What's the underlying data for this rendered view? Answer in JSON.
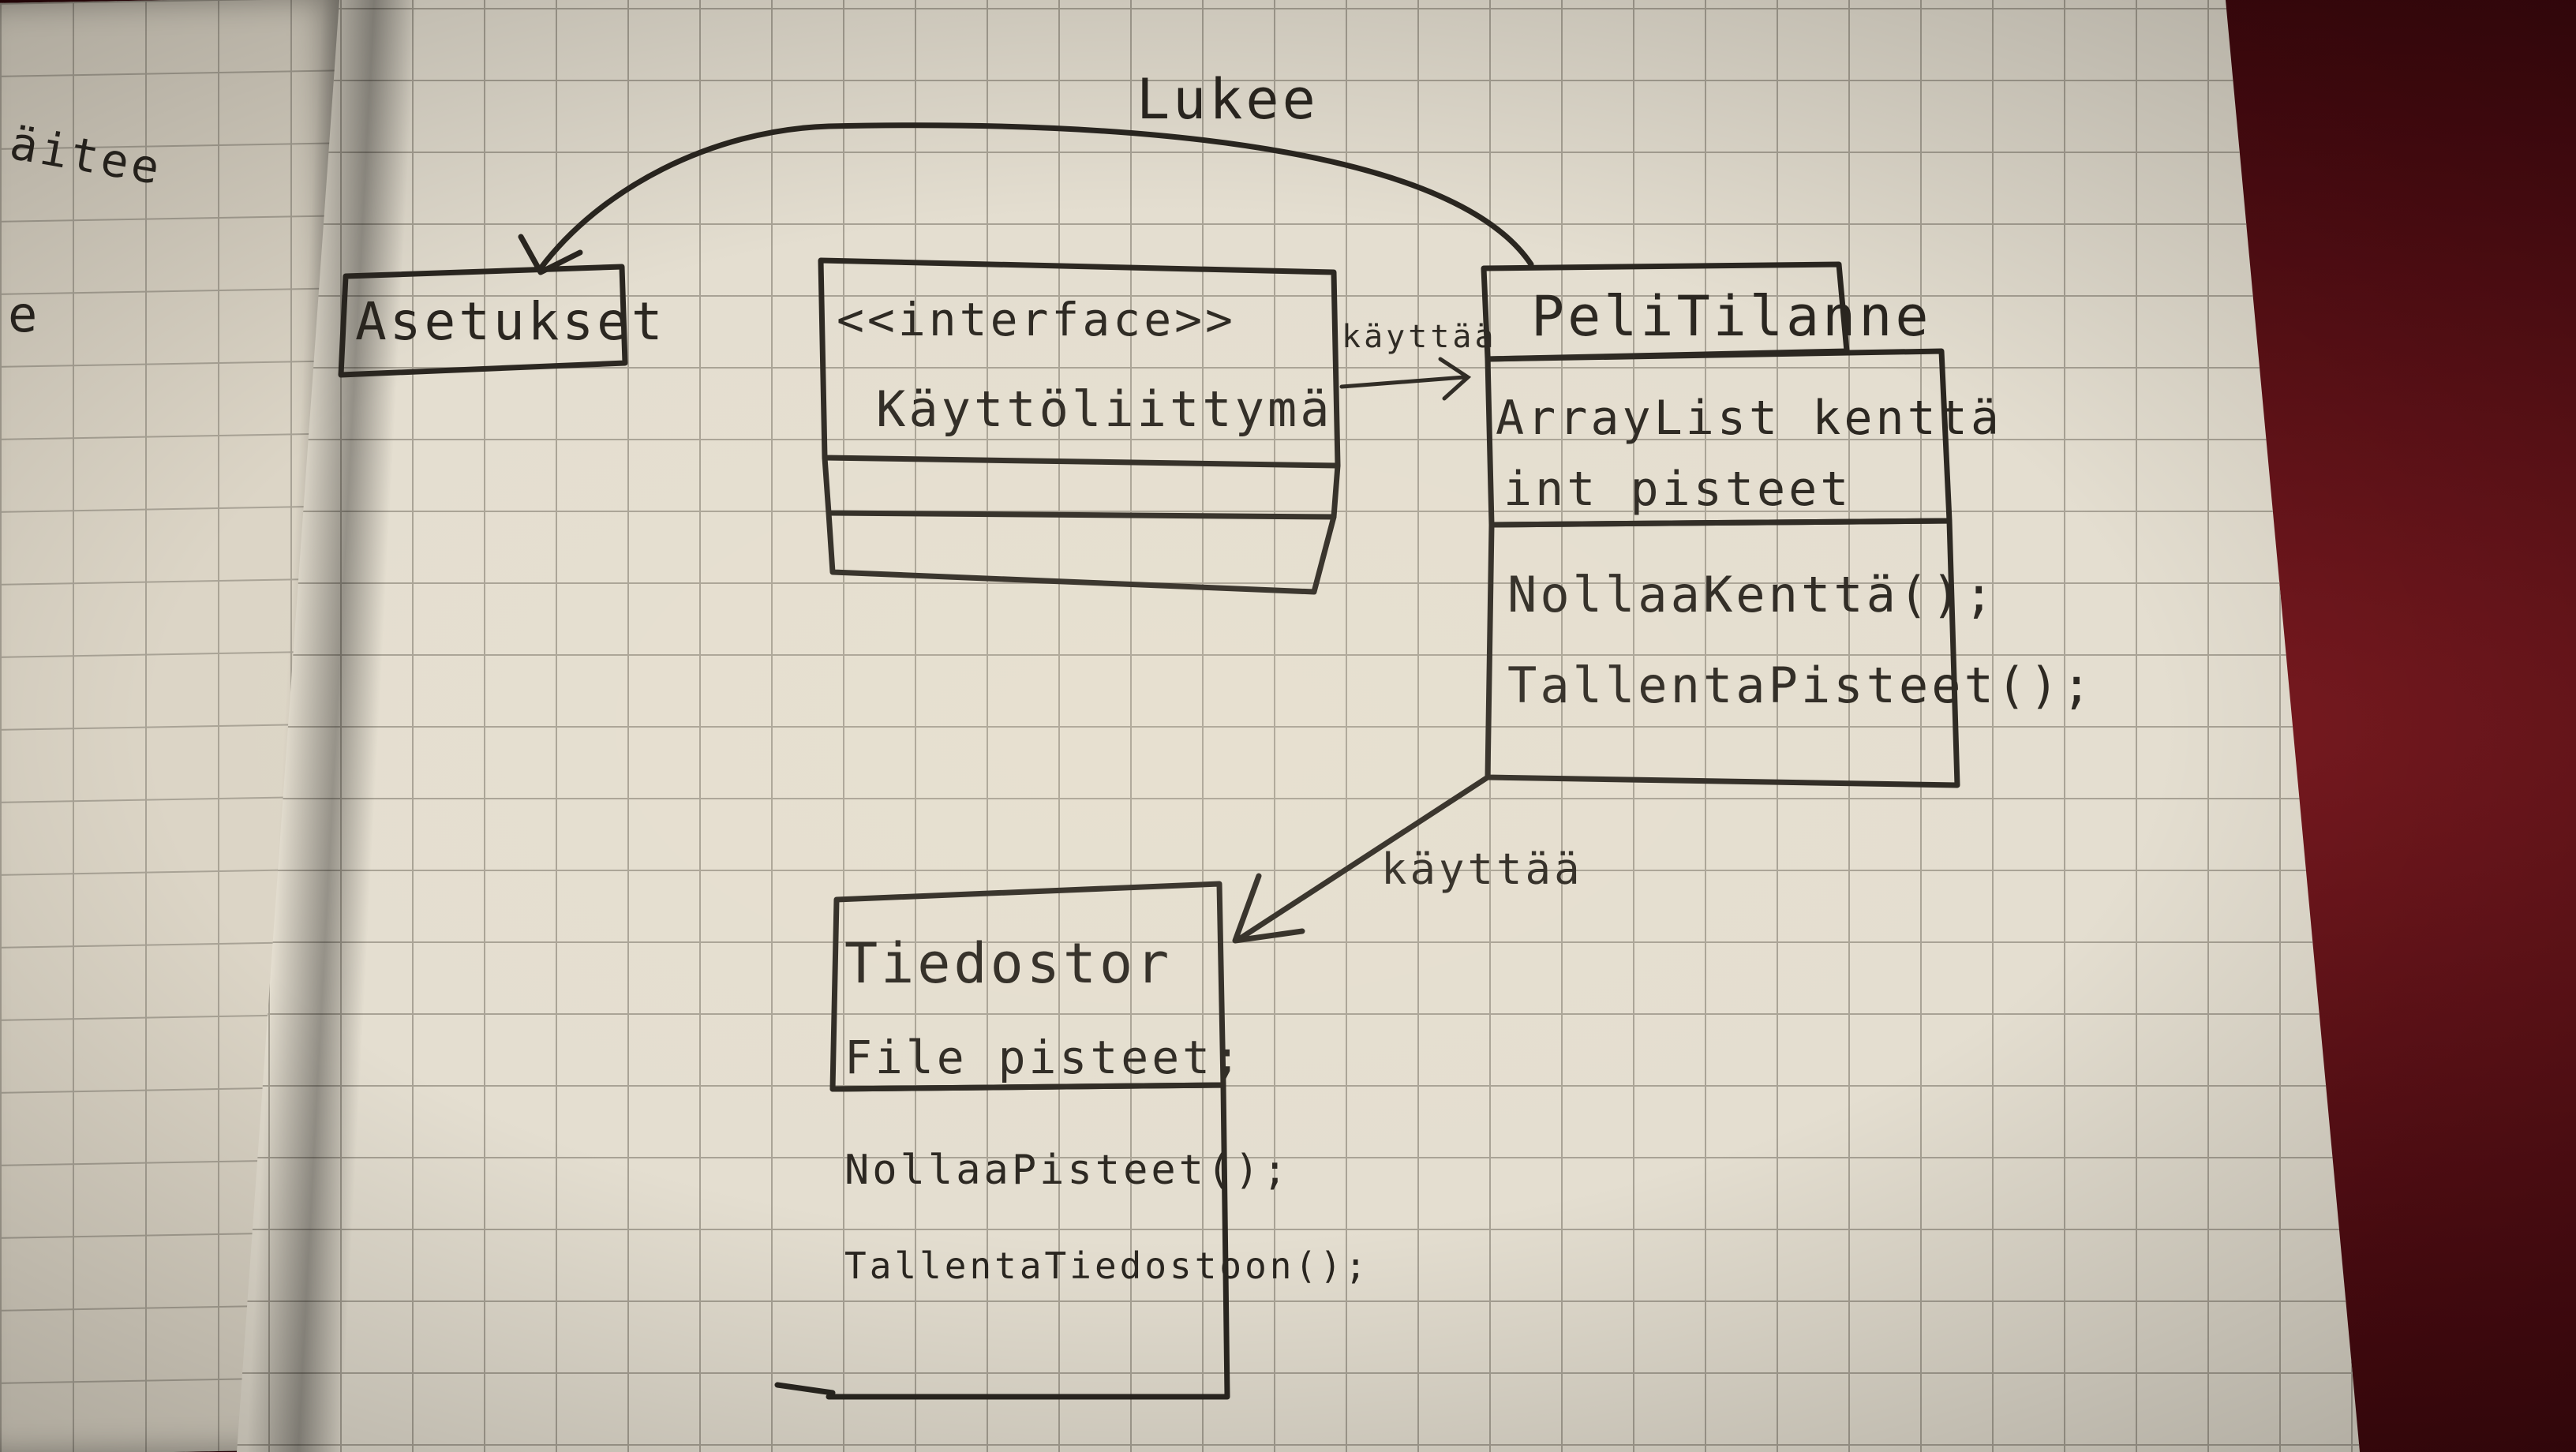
{
  "margin_fragments": [
    "äitee",
    "e"
  ],
  "arrows": {
    "reads_label": "Lukee",
    "uses_top_label": "käyttää",
    "uses_bottom_label": "käyttää"
  },
  "classes": {
    "asetukset": {
      "name": "Asetukset"
    },
    "ui": {
      "stereotype": "<<interface>>",
      "name": "Käyttöliittymä"
    },
    "pelitilanne": {
      "name": "PeliTilanne",
      "attributes": [
        "ArrayList kenttä",
        "int pisteet"
      ],
      "methods": [
        "NollaaKenttä();",
        "TallentaPisteet();"
      ]
    },
    "tiedosto": {
      "name": "Tiedostor",
      "attributes": [
        "File pisteet;"
      ],
      "methods": [
        "NollaaPisteet();",
        "TallentaTiedostoon();"
      ]
    }
  }
}
